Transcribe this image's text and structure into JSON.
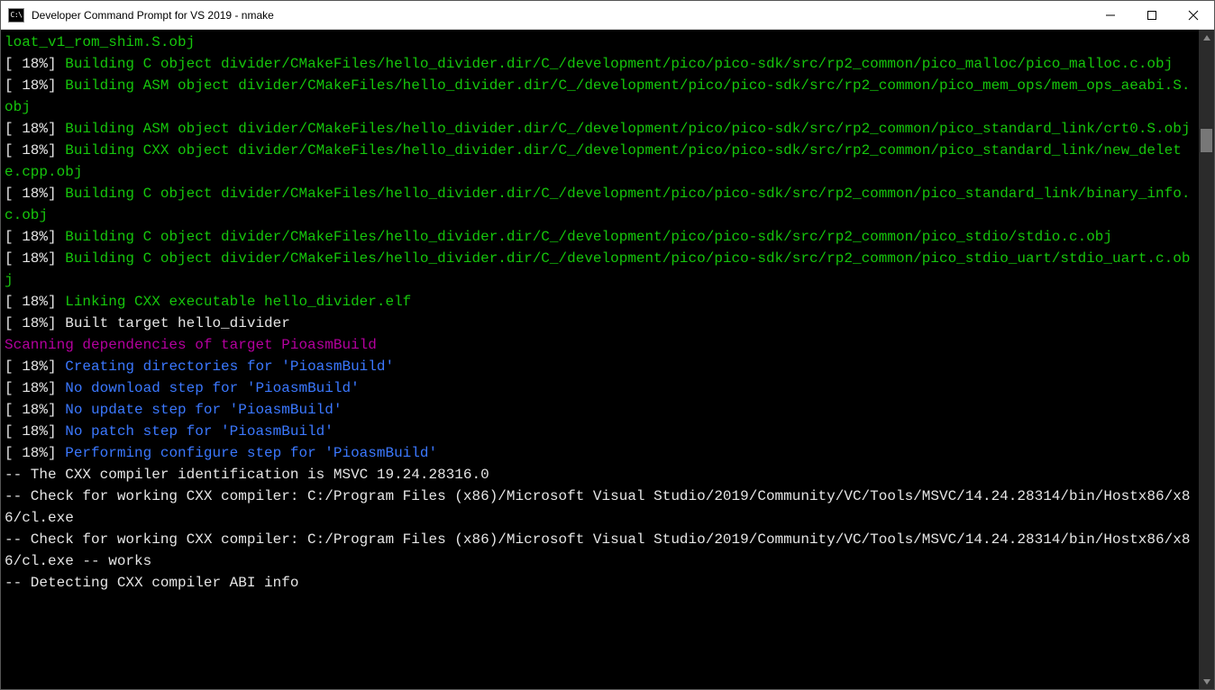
{
  "window": {
    "title": "Developer Command Prompt for VS 2019 - nmake",
    "icon_label": "C:\\"
  },
  "colors": {
    "bg": "#000000",
    "white": "#e5e5e5",
    "green": "#16c60c",
    "blue": "#3b78ff",
    "magenta": "#b4009e"
  },
  "terminal": {
    "lines": [
      {
        "segments": [
          {
            "text": "loat_v1_rom_shim.S.obj",
            "color": "green"
          }
        ]
      },
      {
        "segments": [
          {
            "text": "[ 18%] ",
            "color": "white"
          },
          {
            "text": "Building C object divider/CMakeFiles/hello_divider.dir/C_/development/pico/pico-sdk/src/rp2_common/pico_malloc/pico_malloc.c.obj",
            "color": "green"
          }
        ]
      },
      {
        "segments": [
          {
            "text": "[ 18%] ",
            "color": "white"
          },
          {
            "text": "Building ASM object divider/CMakeFiles/hello_divider.dir/C_/development/pico/pico-sdk/src/rp2_common/pico_mem_ops/mem_ops_aeabi.S.obj",
            "color": "green"
          }
        ]
      },
      {
        "segments": [
          {
            "text": "[ 18%] ",
            "color": "white"
          },
          {
            "text": "Building ASM object divider/CMakeFiles/hello_divider.dir/C_/development/pico/pico-sdk/src/rp2_common/pico_standard_link/crt0.S.obj",
            "color": "green"
          }
        ]
      },
      {
        "segments": [
          {
            "text": "[ 18%] ",
            "color": "white"
          },
          {
            "text": "Building CXX object divider/CMakeFiles/hello_divider.dir/C_/development/pico/pico-sdk/src/rp2_common/pico_standard_link/new_delete.cpp.obj",
            "color": "green"
          }
        ]
      },
      {
        "segments": [
          {
            "text": "[ 18%] ",
            "color": "white"
          },
          {
            "text": "Building C object divider/CMakeFiles/hello_divider.dir/C_/development/pico/pico-sdk/src/rp2_common/pico_standard_link/binary_info.c.obj",
            "color": "green"
          }
        ]
      },
      {
        "segments": [
          {
            "text": "[ 18%] ",
            "color": "white"
          },
          {
            "text": "Building C object divider/CMakeFiles/hello_divider.dir/C_/development/pico/pico-sdk/src/rp2_common/pico_stdio/stdio.c.obj",
            "color": "green"
          }
        ]
      },
      {
        "segments": [
          {
            "text": "[ 18%] ",
            "color": "white"
          },
          {
            "text": "Building C object divider/CMakeFiles/hello_divider.dir/C_/development/pico/pico-sdk/src/rp2_common/pico_stdio_uart/stdio_uart.c.obj",
            "color": "green"
          }
        ]
      },
      {
        "segments": [
          {
            "text": "[ 18%] ",
            "color": "white"
          },
          {
            "text": "Linking CXX executable hello_divider.elf",
            "color": "green"
          }
        ]
      },
      {
        "segments": [
          {
            "text": "[ 18%] Built target hello_divider",
            "color": "white"
          }
        ]
      },
      {
        "segments": [
          {
            "text": "Scanning dependencies of target PioasmBuild",
            "color": "magenta"
          }
        ]
      },
      {
        "segments": [
          {
            "text": "[ 18%] ",
            "color": "white"
          },
          {
            "text": "Creating directories for 'PioasmBuild'",
            "color": "blue"
          }
        ]
      },
      {
        "segments": [
          {
            "text": "[ 18%] ",
            "color": "white"
          },
          {
            "text": "No download step for 'PioasmBuild'",
            "color": "blue"
          }
        ]
      },
      {
        "segments": [
          {
            "text": "[ 18%] ",
            "color": "white"
          },
          {
            "text": "No update step for 'PioasmBuild'",
            "color": "blue"
          }
        ]
      },
      {
        "segments": [
          {
            "text": "[ 18%] ",
            "color": "white"
          },
          {
            "text": "No patch step for 'PioasmBuild'",
            "color": "blue"
          }
        ]
      },
      {
        "segments": [
          {
            "text": "[ 18%] ",
            "color": "white"
          },
          {
            "text": "Performing configure step for 'PioasmBuild'",
            "color": "blue"
          }
        ]
      },
      {
        "segments": [
          {
            "text": "-- The CXX compiler identification is MSVC 19.24.28316.0",
            "color": "white"
          }
        ]
      },
      {
        "segments": [
          {
            "text": "-- Check for working CXX compiler: C:/Program Files (x86)/Microsoft Visual Studio/2019/Community/VC/Tools/MSVC/14.24.28314/bin/Hostx86/x86/cl.exe",
            "color": "white"
          }
        ]
      },
      {
        "segments": [
          {
            "text": "-- Check for working CXX compiler: C:/Program Files (x86)/Microsoft Visual Studio/2019/Community/VC/Tools/MSVC/14.24.28314/bin/Hostx86/x86/cl.exe -- works",
            "color": "white"
          }
        ]
      },
      {
        "segments": [
          {
            "text": "-- Detecting CXX compiler ABI info",
            "color": "white"
          }
        ]
      }
    ]
  }
}
